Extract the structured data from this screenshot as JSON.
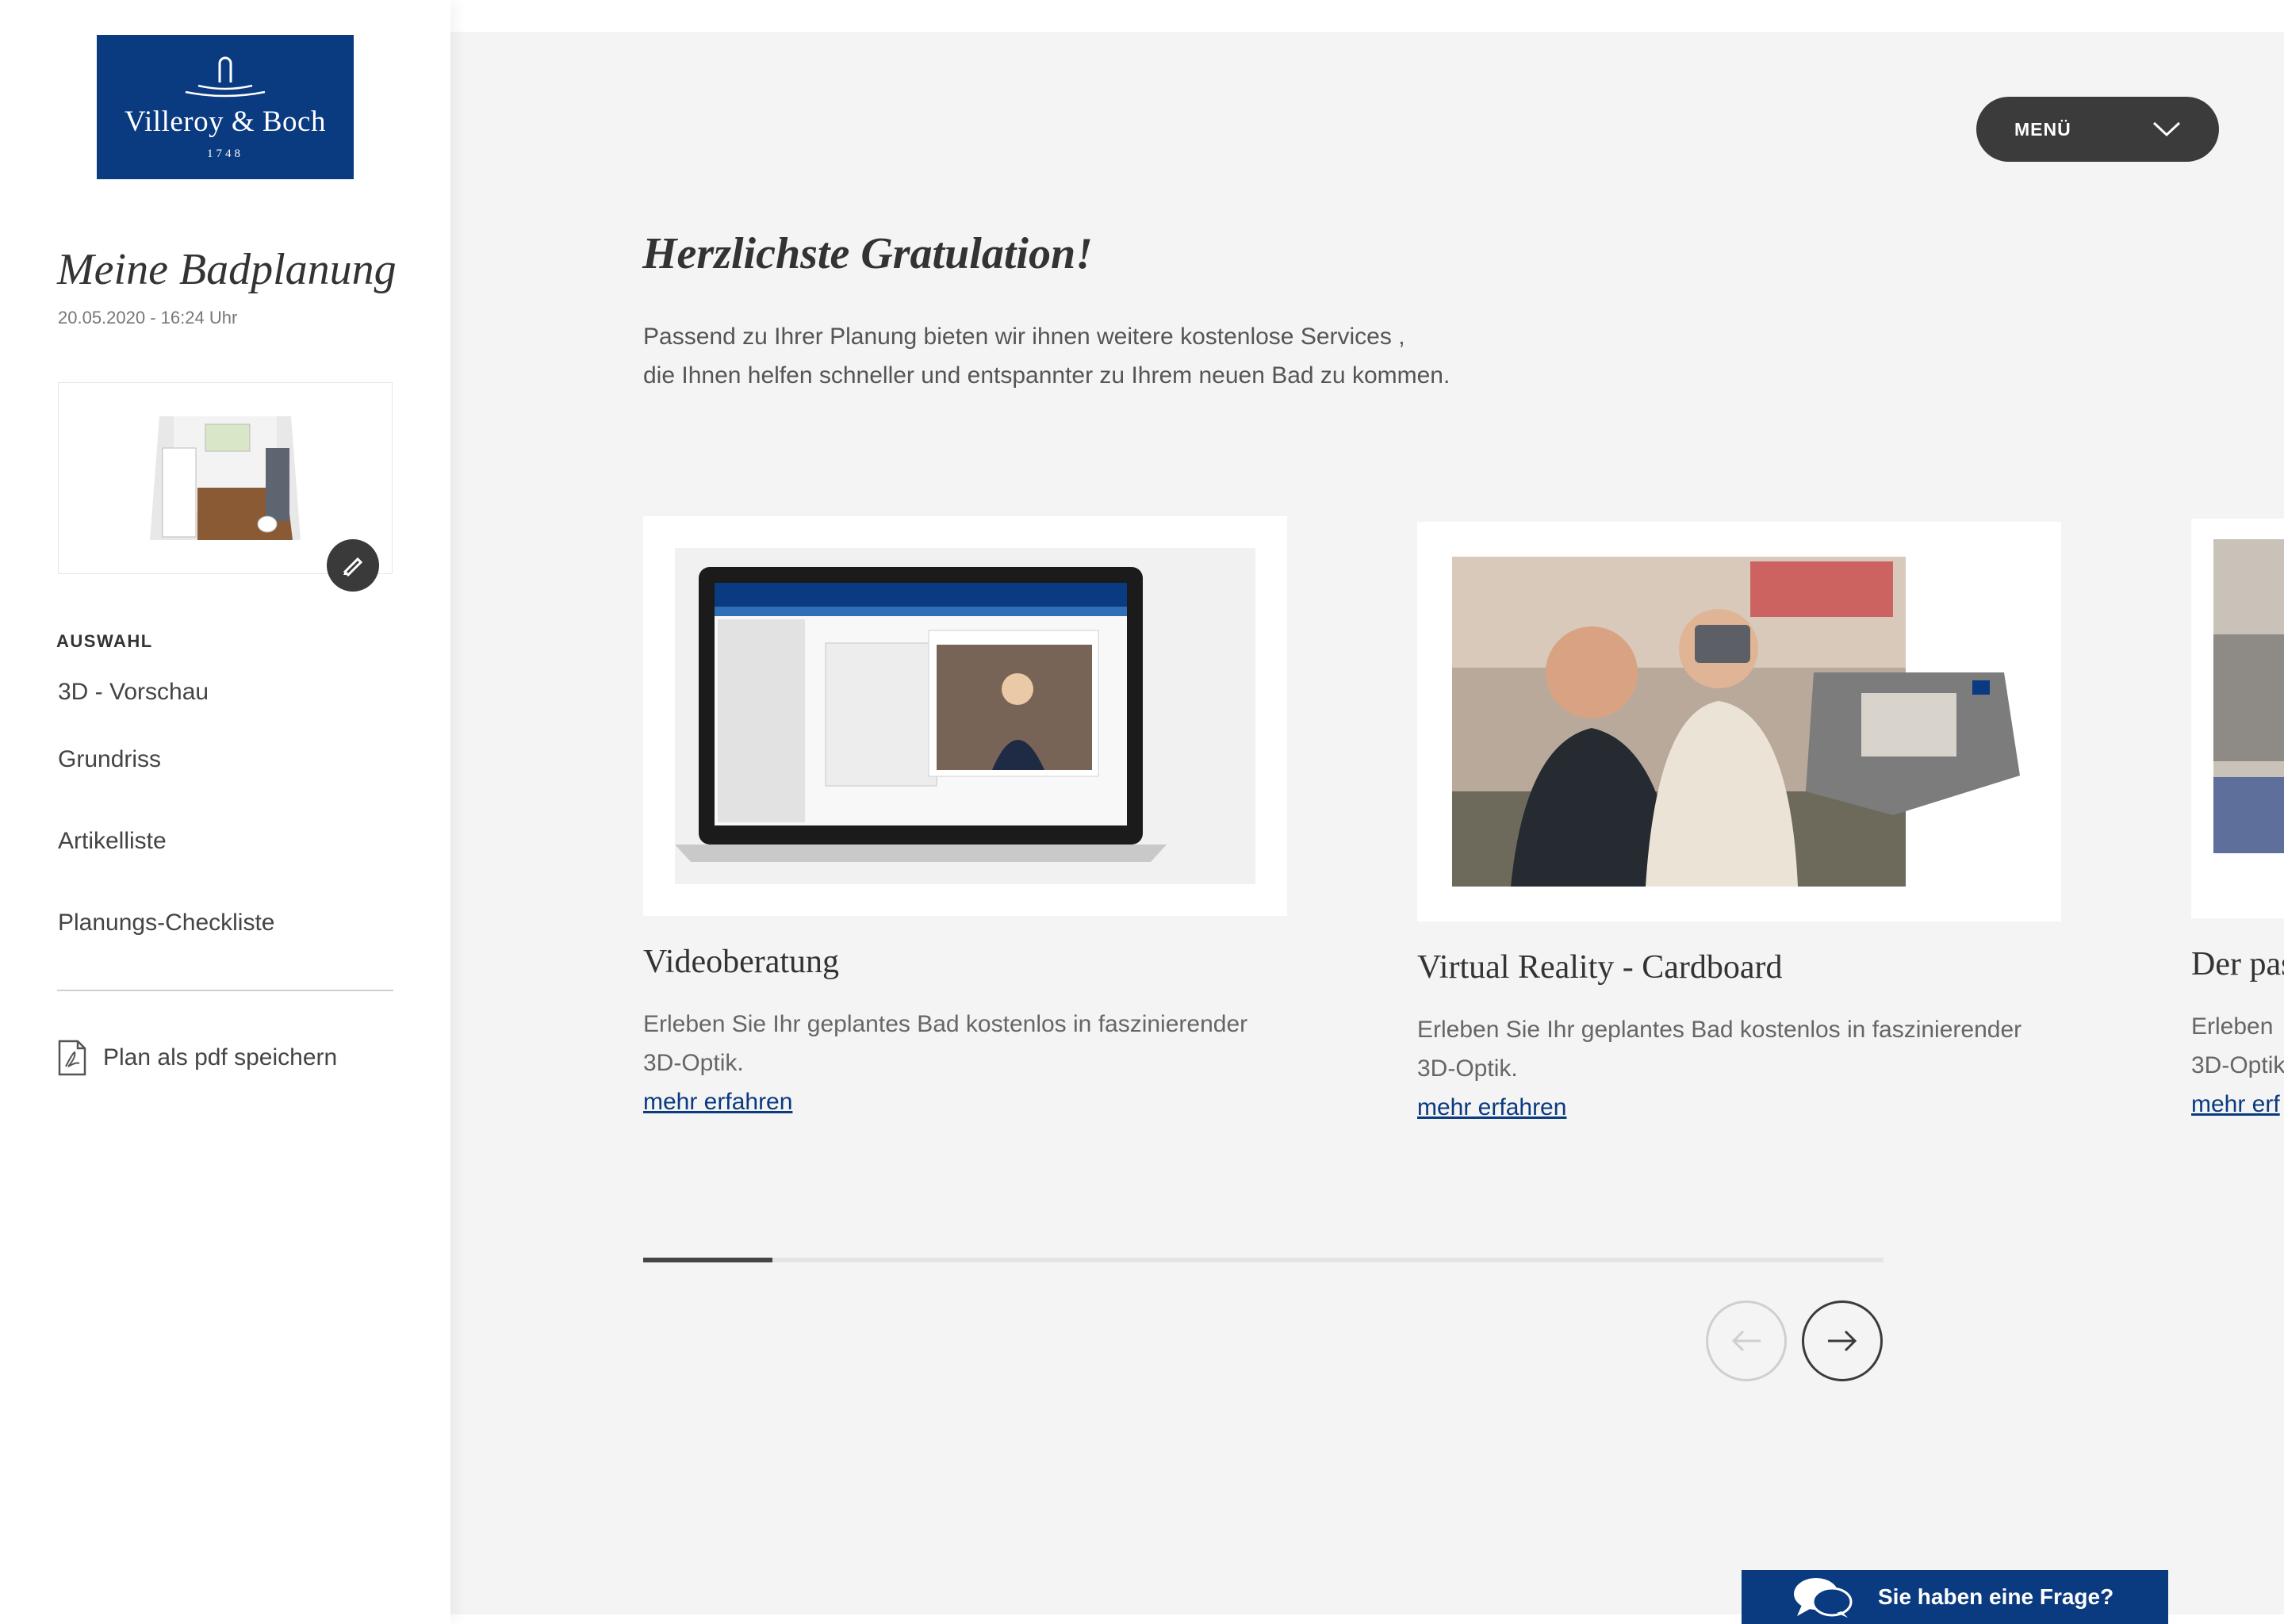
{
  "brand": {
    "name": "Villeroy & Boch",
    "year": "1748",
    "color": "#0a3a80"
  },
  "sidebar": {
    "plan_title": "Meine Badplanung",
    "plan_date": "20.05.2020 - 16:24 Uhr",
    "section_label": "AUSWAHL",
    "items": [
      {
        "label": "3D - Vorschau"
      },
      {
        "label": "Grundriss"
      },
      {
        "label": "Artikelliste"
      },
      {
        "label": "Planungs-Checkliste"
      }
    ],
    "pdf_label": "Plan als pdf speichern",
    "icons": {
      "edit": "pencil-icon",
      "pdf": "pdf-file-icon"
    }
  },
  "header": {
    "menu_label": "MENÜ",
    "menu_icon": "chevron-down-icon"
  },
  "main": {
    "headline": "Herzlichste Gratulation!",
    "intro_line1": "Passend zu Ihrer Planung bieten wir ihnen weitere kostenlose Services ,",
    "intro_line2": "die Ihnen helfen schneller und entspannter zu Ihrem neuen Bad zu kommen.",
    "cards": [
      {
        "title": "Videoberatung",
        "description": "Erleben Sie Ihr geplantes Bad kostenlos in faszinierender 3D-Optik.",
        "link": "mehr erfahren"
      },
      {
        "title": "Virtual Reality - Cardboard",
        "description": "Erleben Sie Ihr geplantes Bad kostenlos in faszinierender 3D-Optik.",
        "link": "mehr erfahren"
      },
      {
        "title": "Der pas",
        "description": "Erleben 3D-Optik",
        "link": "mehr erf"
      }
    ],
    "carousel_progress": 0.104
  },
  "chat": {
    "label": "Sie haben eine Frage?",
    "icon": "chat-bubbles-icon"
  }
}
